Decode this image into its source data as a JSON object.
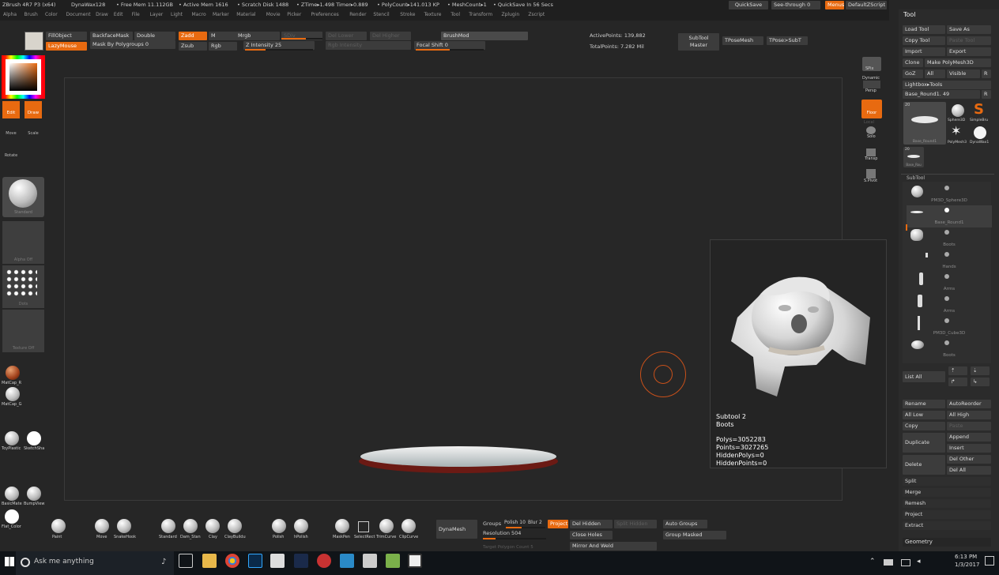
{
  "titlebar": {
    "app": "ZBrush 4R7 P3 (x64)",
    "doc": "DynaWax128",
    "free_mem": "• Free Mem 11.112GB",
    "active_mem": "• Active Mem 1616",
    "scratch": "• Scratch Disk 1488",
    "ztime": "• ZTime▸1.498 Timer▸0.889",
    "polycount": "• PolyCount▸141.013 KP",
    "meshcount": "• MeshCount▸1",
    "quicksave": "• QuickSave In 56 Secs",
    "quicksave_btn": "QuickSave",
    "seethrough": "See-through",
    "seethrough_val": "0",
    "menus_btn": "Menus",
    "script": "DefaultZScript"
  },
  "menus": [
    "Alpha",
    "Brush",
    "Color",
    "Document",
    "Draw",
    "Edit",
    "File",
    "Layer",
    "Light",
    "Macro",
    "Marker",
    "Material",
    "Movie",
    "Picker",
    "Preferences",
    "Render",
    "Stencil",
    "Stroke",
    "Texture",
    "Tool",
    "Transform",
    "Zplugin",
    "Zscript"
  ],
  "topstrip": {
    "fill_object": "FillObject",
    "lazy_mouse": "LazyMouse",
    "backface_mask": "BackfaceMask",
    "double": "Double",
    "mask_by_polygroups": "Mask By Polygroups 0",
    "zadd": "Zadd",
    "zsub": "Zsub",
    "m": "M",
    "rgb": "Rgb",
    "mrgb": "Mrgb",
    "z_intensity": "Z Intensity 25",
    "sdiv": "SDiv",
    "rgb_intensity": "Rgb Intensity",
    "del_lower": "Del Lower",
    "del_higher": "Del Higher",
    "focal_shift": "Focal Shift 0",
    "brushmod": "BrushMod",
    "active_points": "ActivePoints: 139,882",
    "total_points": "TotalPoints: 7.282 Mil",
    "subtool_master": "SubTool Master",
    "tpose_mesh": "TPoseMesh",
    "tpose_subt": "TPose>SubT"
  },
  "leftshelf": {
    "edit": "Edit",
    "draw": "Draw",
    "move": "Move",
    "scale": "Scale",
    "rotate": "Rotate",
    "brush_name": "Standard",
    "alpha_label": "Alpha Off",
    "stroke_label": "Dots",
    "texture_label": "Texture Off",
    "matcap_r": "MatCap_R",
    "matcap_g": "MatCap_G",
    "toyplastic": "ToyPlastic",
    "sketchsha": "SketchSha",
    "basicmate": "BasicMate",
    "bumpview": "BumpView",
    "flat_color": "Flat_Color"
  },
  "rightshelf": {
    "spix": "SPix",
    "dynamic": "Dynamic",
    "persp": "Persp",
    "floor": "Floor",
    "local": "Local",
    "solo": "Solo",
    "transp": "Transp",
    "spivot": "S.Pivot"
  },
  "info_panel": {
    "subtool": "Subtool 2",
    "name": "Boots",
    "polys": "Polys=3052283",
    "points": "Points=3027265",
    "hidden_polys": "HiddenPolys=0",
    "hidden_points": "HiddenPoints=0"
  },
  "tool_panel": {
    "title": "Tool",
    "load_tool": "Load Tool",
    "save_as": "Save As",
    "copy_tool": "Copy Tool",
    "paste_tool": "Paste Tool",
    "import": "Import",
    "export": "Export",
    "clone": "Clone",
    "make_polymesh": "Make PolyMesh3D",
    "goz": "GoZ",
    "all": "All",
    "visible": "Visible",
    "r": "R",
    "lightbox_tools": "Lightbox▸Tools",
    "current_tool": "Base_Round1. 49",
    "thumb_count": "20",
    "thumbs": [
      "Sphere3D",
      "SimpleBru",
      "PolyMesh3",
      "DynaWax1"
    ],
    "main_thumb": "Base_Round1",
    "small_thumb_count": "20",
    "small_thumb": "Base_Rou"
  },
  "subtool": {
    "header": "SubTool",
    "items": [
      "PM3D_Sphere3D",
      "Base_Round1",
      "Boots",
      "Hands",
      "Arms",
      "Arms",
      "PM3D_Cube3D",
      "Boots"
    ],
    "list_all": "List All",
    "rename": "Rename",
    "auto_reorder": "AutoReorder",
    "all_low": "All Low",
    "all_high": "All High",
    "copy": "Copy",
    "paste": "Paste",
    "duplicate": "Duplicate",
    "append": "Append",
    "insert": "Insert",
    "delete": "Delete",
    "del_other": "Del Other",
    "del_all": "Del All",
    "split": "Split",
    "merge": "Merge",
    "remesh": "Remesh",
    "project": "Project",
    "extract": "Extract",
    "geometry": "Geometry"
  },
  "bottomshelf": {
    "brushes": [
      "Paint",
      "Move",
      "SnakeHook",
      "Standard",
      "Dam_Stan",
      "Clay",
      "ClayBuildu",
      "Polish",
      "hPolish",
      "MaskPen",
      "SelectRect",
      "TrimCurve",
      "ClipCurve"
    ],
    "dynamesh": "DynaMesh",
    "groups": "Groups",
    "polish": "Polish 10",
    "blur": "Blur 2",
    "project": "Project",
    "resolution": "Resolution 504",
    "del_hidden": "Del Hidden",
    "split_hidden": "Split Hidden",
    "close_holes": "Close Holes",
    "mirror_weld": "Mirror And Weld",
    "auto_groups": "Auto Groups",
    "group_masked": "Group Masked",
    "target_poly": "Target Polygon Count 5"
  },
  "taskbar": {
    "search_placeholder": "Ask me anything",
    "time": "6:13 PM",
    "date": "1/3/2017"
  }
}
